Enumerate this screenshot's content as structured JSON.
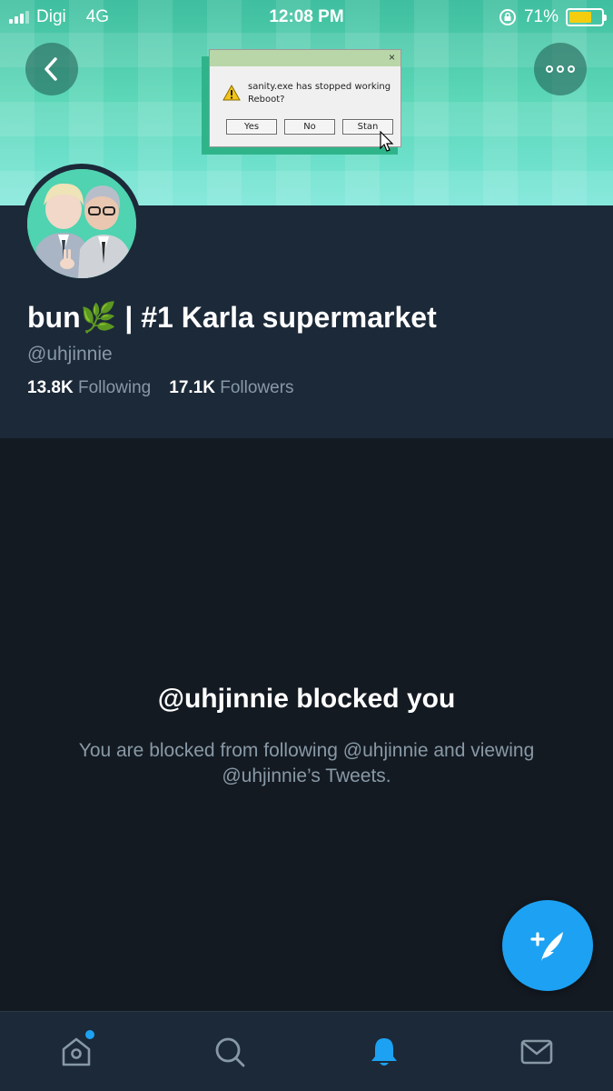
{
  "status_bar": {
    "carrier": "Digi",
    "network": "4G",
    "time": "12:08 PM",
    "battery_percent": "71%",
    "battery_level": 0.71,
    "signal_bars": 3
  },
  "banner": {
    "dialog": {
      "message_line1": "sanity.exe has stopped working",
      "message_line2": "Reboot?",
      "close_glyph": "×",
      "buttons": [
        "Yes",
        "No",
        "Stan"
      ]
    }
  },
  "profile": {
    "display_name": "bun🌿 | #1 Karla supermarket",
    "handle": "@uhjinnie",
    "following_count": "13.8K",
    "following_label": "Following",
    "followers_count": "17.1K",
    "followers_label": "Followers"
  },
  "blocked": {
    "title": "@uhjinnie blocked you",
    "description": "You are blocked from following @uhjinnie and viewing @uhjinnie’s Tweets."
  },
  "fab": {
    "icon": "compose-tweet-icon"
  },
  "tabbar": {
    "items": [
      {
        "icon": "home-icon",
        "active": false,
        "has_badge": true
      },
      {
        "icon": "search-icon",
        "active": false
      },
      {
        "icon": "notifications-bell-icon",
        "active": true
      },
      {
        "icon": "messages-envelope-icon",
        "active": false
      }
    ]
  },
  "colors": {
    "background": "#141a22",
    "header_bg": "#1c2938",
    "muted_text": "#8899a6",
    "accent": "#1da1f2",
    "banner_teal": "#5ad6b6"
  }
}
